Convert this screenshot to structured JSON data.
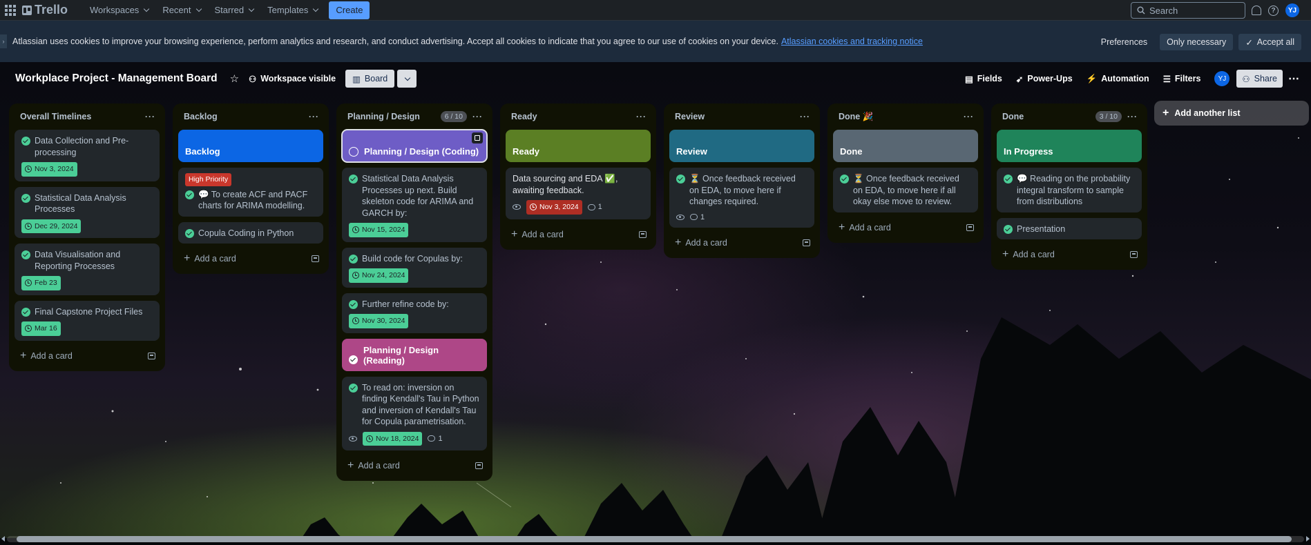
{
  "topnav": {
    "logo": "Trello",
    "items": [
      {
        "label": "Workspaces"
      },
      {
        "label": "Recent"
      },
      {
        "label": "Starred"
      },
      {
        "label": "Templates"
      }
    ],
    "create_label": "Create",
    "search_placeholder": "Search",
    "avatar_initials": "YJ"
  },
  "cookie": {
    "message": "Atlassian uses cookies to improve your browsing experience, perform analytics and research, and conduct advertising. Accept all cookies to indicate that you agree to our use of cookies on your device.",
    "link": "Atlassian cookies and tracking notice",
    "preferences": "Preferences",
    "only_necessary": "Only necessary",
    "accept_all": "Accept all"
  },
  "board": {
    "title": "Workplace Project - Management Board",
    "visibility": "Workspace visible",
    "view": "Board",
    "fields": "Fields",
    "powerups": "Power-Ups",
    "automation": "Automation",
    "filters": "Filters",
    "share": "Share",
    "avatar_initials": "YJ",
    "add_list": "Add another list",
    "add_card": "Add a card"
  },
  "lists": [
    {
      "title": "Overall Timelines",
      "count": "",
      "cards": [
        {
          "text": "Data Collection and Pre-processing",
          "date": "Nov 3, 2024"
        },
        {
          "text": "Statistical Data Analysis Processes",
          "date": "Dec 29, 2024"
        },
        {
          "text": "Data Visualisation and Reporting Processes",
          "date": "Feb 23"
        },
        {
          "text": "Final Capstone Project Files",
          "date": "Mar 16"
        }
      ]
    },
    {
      "title": "Backlog",
      "count": "",
      "cover": {
        "title": "Backlog",
        "color": "#0c66e4"
      },
      "cards": [
        {
          "label": "High Priority",
          "text": "💬 To create ACF and PACF charts for ARIMA modelling."
        },
        {
          "text": "Copula Coding in Python"
        }
      ]
    },
    {
      "title": "Planning / Design",
      "count": "6 / 10",
      "cover": {
        "title": "Planning / Design (Coding)",
        "color": "#6e5dc6"
      },
      "cards": [
        {
          "text": "Statistical Data Analysis Processes up next. Build skeleton code for ARIMA and GARCH by:",
          "date": "Nov 15, 2024"
        },
        {
          "text": "Build code for Copulas by:",
          "date": "Nov 24, 2024"
        },
        {
          "text": "Further refine code by:",
          "date": "Nov 30, 2024"
        }
      ],
      "cover2": {
        "title": "Planning / Design (Reading)",
        "color": "#ae4787"
      },
      "cards2": [
        {
          "text": "To read on: inversion on finding Kendall's Tau in Python and inversion of Kendall's Tau for Copula parametrisation.",
          "date": "Nov 18, 2024",
          "comments": "1"
        }
      ]
    },
    {
      "title": "Ready",
      "count": "",
      "cover": {
        "title": "Ready",
        "color": "#5b7f24"
      },
      "cards": [
        {
          "text": "Data sourcing and EDA ✅, awaiting feedback.",
          "date": "Nov 3, 2024",
          "comments": "1"
        }
      ]
    },
    {
      "title": "Review",
      "count": "",
      "cover": {
        "title": "Review",
        "color": "#206a83"
      },
      "cards": [
        {
          "text": "⏳ Once feedback received on EDA, to move here if changes required.",
          "comments": "1"
        }
      ]
    },
    {
      "title": "Done 🎉",
      "count": "",
      "cover": {
        "title": "Done",
        "color": "#596773"
      },
      "cards": [
        {
          "text": "⏳ Once feedback received on EDA, to move here if all okay else move to review."
        }
      ]
    },
    {
      "title": "Done",
      "count": "3 / 10",
      "cover": {
        "title": "In Progress",
        "color": "#1f845a"
      },
      "cards": [
        {
          "text": "💬 Reading on the probability integral transform to sample from distributions"
        },
        {
          "text": "Presentation"
        }
      ]
    }
  ]
}
